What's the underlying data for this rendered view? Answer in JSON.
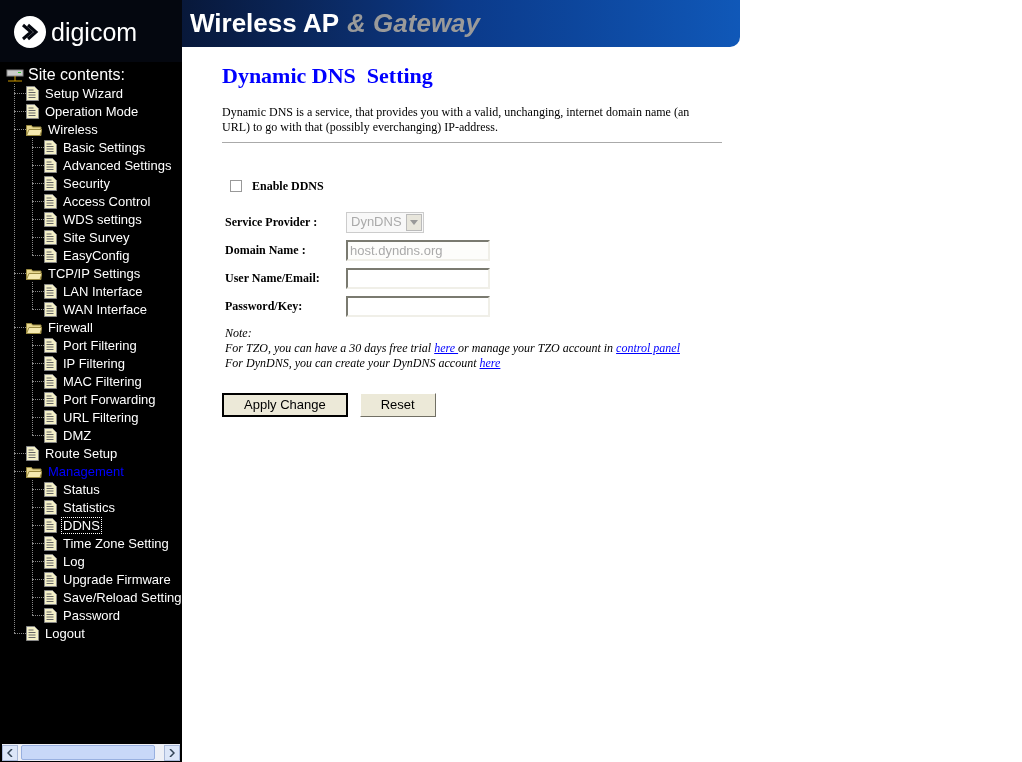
{
  "header": {
    "brand": "digicom",
    "title": "Wireless AP",
    "subtitle": "& Gateway"
  },
  "sidebar": {
    "heading": "Site contents:",
    "items": [
      {
        "label": "Setup Wizard",
        "kind": "page",
        "selected": false,
        "highlighted": false
      },
      {
        "label": "Operation Mode",
        "kind": "page",
        "selected": false,
        "highlighted": false
      },
      {
        "label": "Wireless",
        "kind": "folder",
        "selected": false,
        "highlighted": false,
        "children": [
          {
            "label": "Basic Settings",
            "kind": "page",
            "selected": false,
            "highlighted": false
          },
          {
            "label": "Advanced Settings",
            "kind": "page",
            "selected": false,
            "highlighted": false
          },
          {
            "label": "Security",
            "kind": "page",
            "selected": false,
            "highlighted": false
          },
          {
            "label": "Access Control",
            "kind": "page",
            "selected": false,
            "highlighted": false
          },
          {
            "label": "WDS settings",
            "kind": "page",
            "selected": false,
            "highlighted": false
          },
          {
            "label": "Site Survey",
            "kind": "page",
            "selected": false,
            "highlighted": false
          },
          {
            "label": "EasyConfig",
            "kind": "page",
            "selected": false,
            "highlighted": false
          }
        ]
      },
      {
        "label": "TCP/IP Settings",
        "kind": "folder",
        "selected": false,
        "highlighted": false,
        "children": [
          {
            "label": "LAN Interface",
            "kind": "page",
            "selected": false,
            "highlighted": false
          },
          {
            "label": "WAN Interface",
            "kind": "page",
            "selected": false,
            "highlighted": false
          }
        ]
      },
      {
        "label": "Firewall",
        "kind": "folder",
        "selected": false,
        "highlighted": false,
        "children": [
          {
            "label": "Port Filtering",
            "kind": "page",
            "selected": false,
            "highlighted": false
          },
          {
            "label": "IP Filtering",
            "kind": "page",
            "selected": false,
            "highlighted": false
          },
          {
            "label": "MAC Filtering",
            "kind": "page",
            "selected": false,
            "highlighted": false
          },
          {
            "label": "Port Forwarding",
            "kind": "page",
            "selected": false,
            "highlighted": false
          },
          {
            "label": "URL Filtering",
            "kind": "page",
            "selected": false,
            "highlighted": false
          },
          {
            "label": "DMZ",
            "kind": "page",
            "selected": false,
            "highlighted": false
          }
        ]
      },
      {
        "label": "Route Setup",
        "kind": "page",
        "selected": false,
        "highlighted": false
      },
      {
        "label": "Management",
        "kind": "folder",
        "selected": false,
        "highlighted": true,
        "children": [
          {
            "label": "Status",
            "kind": "page",
            "selected": false,
            "highlighted": false
          },
          {
            "label": "Statistics",
            "kind": "page",
            "selected": false,
            "highlighted": false
          },
          {
            "label": "DDNS",
            "kind": "page",
            "selected": true,
            "highlighted": false
          },
          {
            "label": "Time Zone Setting",
            "kind": "page",
            "selected": false,
            "highlighted": false
          },
          {
            "label": "Log",
            "kind": "page",
            "selected": false,
            "highlighted": false
          },
          {
            "label": "Upgrade Firmware",
            "kind": "page",
            "selected": false,
            "highlighted": false
          },
          {
            "label": "Save/Reload Setting",
            "kind": "page",
            "selected": false,
            "highlighted": false
          },
          {
            "label": "Password",
            "kind": "page",
            "selected": false,
            "highlighted": false
          }
        ]
      },
      {
        "label": "Logout",
        "kind": "page",
        "selected": false,
        "highlighted": false
      }
    ]
  },
  "page": {
    "title": "Dynamic DNS  Setting",
    "description": "Dynamic DNS is a service, that provides you with a valid, unchanging, internet domain name (an URL) to go with that (possibly everchanging) IP-address.",
    "enable": {
      "label": "Enable DDNS",
      "checked": false
    },
    "fields": [
      {
        "label": "Service Provider :",
        "kind": "select",
        "value": "DynDNS",
        "disabled": true
      },
      {
        "label": "Domain Name :",
        "kind": "text",
        "value": "host.dyndns.org",
        "disabled": true
      },
      {
        "label": "User Name/Email:",
        "kind": "text"
      },
      {
        "label": "Password/Key:",
        "kind": "text"
      }
    ],
    "note": {
      "heading": "Note:",
      "lines": [
        [
          {
            "text": "For TZO, you can have a 30 days free trial "
          },
          {
            "text": "here ",
            "link": true
          },
          {
            "text": "or manage your TZO account in "
          },
          {
            "text": "control panel",
            "link": true
          }
        ],
        [
          {
            "text": "For DynDNS, you can create your DynDNS account "
          },
          {
            "text": "here",
            "link": true
          }
        ]
      ]
    },
    "buttons": [
      {
        "label": "Apply Change",
        "default": true
      },
      {
        "label": "Reset",
        "default": false
      }
    ]
  }
}
